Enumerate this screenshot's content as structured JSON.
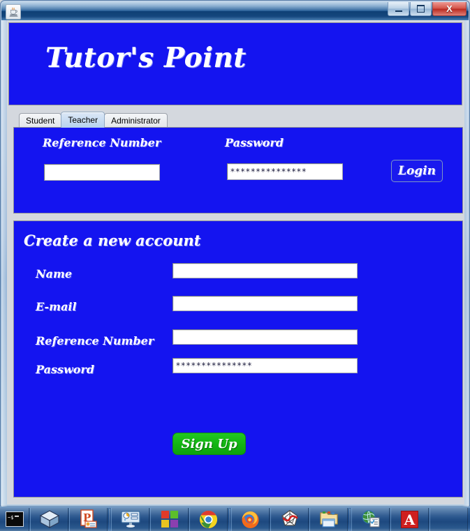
{
  "window": {
    "title": "",
    "app_icon": "java-coffee-cup-icon",
    "controls": {
      "minimize_label": "",
      "maximize_label": "",
      "close_label": "X"
    }
  },
  "banner": {
    "title": "Tutor's Point"
  },
  "tabs": [
    {
      "label": "Student",
      "selected": false
    },
    {
      "label": "Teacher",
      "selected": true
    },
    {
      "label": "Administrator",
      "selected": false
    }
  ],
  "login_panel": {
    "reference_number": {
      "label": "Reference Number",
      "value": "",
      "placeholder": ""
    },
    "password": {
      "label": "Password",
      "value": "***************",
      "placeholder": ""
    },
    "login_button": "Login"
  },
  "signup_panel": {
    "heading": "Create a new account",
    "fields": [
      {
        "label": "Name",
        "value": "",
        "type": "text"
      },
      {
        "label": "E-mail",
        "value": "",
        "type": "text"
      },
      {
        "label": "Reference Number",
        "value": "",
        "type": "text"
      },
      {
        "label": "Password",
        "value": "***************",
        "type": "password"
      }
    ],
    "signup_button": "Sign Up"
  },
  "taskbar": {
    "items": [
      {
        "name": "terminal-icon",
        "label": "Terminal"
      },
      {
        "name": "virtualbox-cube-icon",
        "label": "VirtualBox"
      },
      {
        "name": "powerpoint-icon",
        "label": "PowerPoint"
      },
      {
        "name": "presentation-icon",
        "label": "Presentation"
      },
      {
        "name": "windows-logo-icon",
        "label": "Windows"
      },
      {
        "name": "chrome-icon",
        "label": "Google Chrome"
      },
      {
        "name": "firefox-icon",
        "label": "Mozilla Firefox"
      },
      {
        "name": "spiderweb-icon",
        "label": "Web Tool"
      },
      {
        "name": "folder-window-icon",
        "label": "File Explorer"
      },
      {
        "name": "globe-checklist-icon",
        "label": "Web Checklist"
      },
      {
        "name": "acrobat-icon",
        "label": "Adobe Acrobat"
      }
    ]
  },
  "colors": {
    "panel_blue": "#1414f0",
    "button_green": "#13b413",
    "close_red": "#ba2c23",
    "text_white": "#ffffff"
  }
}
